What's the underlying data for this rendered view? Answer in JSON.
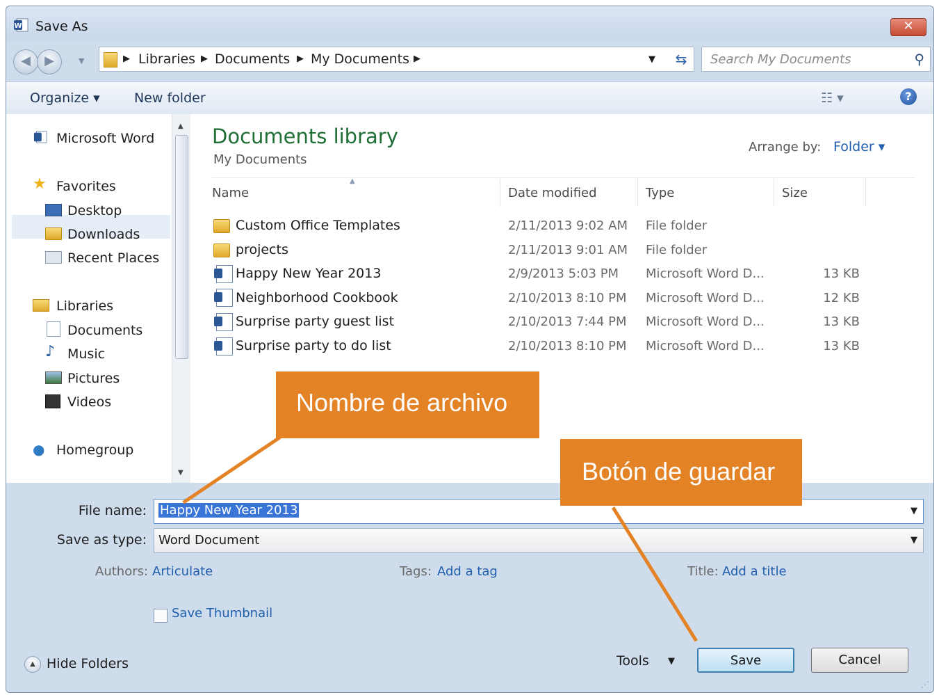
{
  "window": {
    "title": "Save As",
    "close_label": "✕",
    "app_icon": "word-icon"
  },
  "address": {
    "crumbs": [
      "Libraries",
      "Documents",
      "My Documents"
    ],
    "search_placeholder": "Search My Documents"
  },
  "toolbar": {
    "organize_label": "Organize ▾",
    "new_folder_label": "New folder",
    "help_label": "?"
  },
  "sidebar": {
    "items": [
      {
        "label": "Microsoft Word",
        "icon": "word-icon"
      },
      {
        "label": "Favorites",
        "icon": "star-icon"
      },
      {
        "label": "Desktop",
        "icon": "desktop-icon"
      },
      {
        "label": "Downloads",
        "icon": "downloads-icon"
      },
      {
        "label": "Recent Places",
        "icon": "recent-places-icon"
      },
      {
        "label": "Libraries",
        "icon": "libraries-icon"
      },
      {
        "label": "Documents",
        "icon": "document-icon"
      },
      {
        "label": "Music",
        "icon": "music-icon"
      },
      {
        "label": "Pictures",
        "icon": "pictures-icon"
      },
      {
        "label": "Videos",
        "icon": "videos-icon"
      },
      {
        "label": "Homegroup",
        "icon": "homegroup-icon"
      }
    ]
  },
  "library": {
    "title": "Documents library",
    "subtitle": "My Documents",
    "arrange_label": "Arrange by:",
    "arrange_value": "Folder ▾"
  },
  "columns": [
    "Name",
    "Date modified",
    "Type",
    "Size"
  ],
  "files": [
    {
      "name": "Custom Office Templates",
      "date": "2/11/2013 9:02 AM",
      "type": "File folder",
      "size": "",
      "icon": "folder-icon"
    },
    {
      "name": "projects",
      "date": "2/11/2013 9:01 AM",
      "type": "File folder",
      "size": "",
      "icon": "folder-icon"
    },
    {
      "name": "Happy New Year 2013",
      "date": "2/9/2013 5:03 PM",
      "type": "Microsoft Word D...",
      "size": "13 KB",
      "icon": "word-document-icon"
    },
    {
      "name": "Neighborhood Cookbook",
      "date": "2/10/2013 8:10 PM",
      "type": "Microsoft Word D...",
      "size": "12 KB",
      "icon": "word-document-icon"
    },
    {
      "name": "Surprise party guest list",
      "date": "2/10/2013 7:44 PM",
      "type": "Microsoft Word D...",
      "size": "13 KB",
      "icon": "word-document-icon"
    },
    {
      "name": "Surprise party to do list",
      "date": "2/10/2013 8:10 PM",
      "type": "Microsoft Word D...",
      "size": "13 KB",
      "icon": "word-document-icon"
    }
  ],
  "form": {
    "file_name_label": "File name:",
    "file_name_value": "Happy New Year 2013",
    "save_type_label": "Save as type:",
    "save_type_value": "Word Document",
    "authors_label": "Authors:",
    "authors_value": "Articulate",
    "tags_label": "Tags:",
    "tags_value": "Add a tag",
    "title_label": "Title:",
    "title_value": "Add a title",
    "thumbnail_label": "Save Thumbnail"
  },
  "footer": {
    "hide_folders_label": "Hide Folders",
    "tools_label": "Tools",
    "save_label": "Save",
    "cancel_label": "Cancel"
  },
  "callouts": {
    "filename": "Nombre de archivo",
    "save_button": "Botón de guardar"
  },
  "colors": {
    "accent_orange": "#e48325",
    "library_green": "#1f6f36",
    "link_blue": "#1e5fae",
    "selection_blue": "#3875d7"
  }
}
